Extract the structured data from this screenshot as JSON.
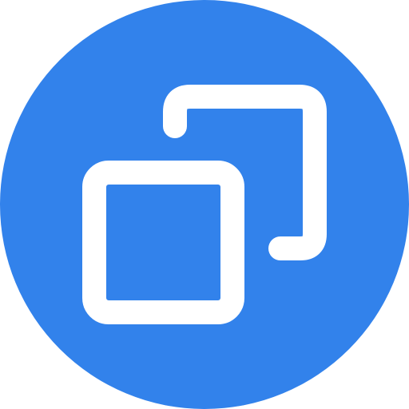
{
  "icon": {
    "name": "copy-duplicate-icon",
    "background_color": "#3282EB",
    "stroke_color": "#FFFFFF"
  }
}
